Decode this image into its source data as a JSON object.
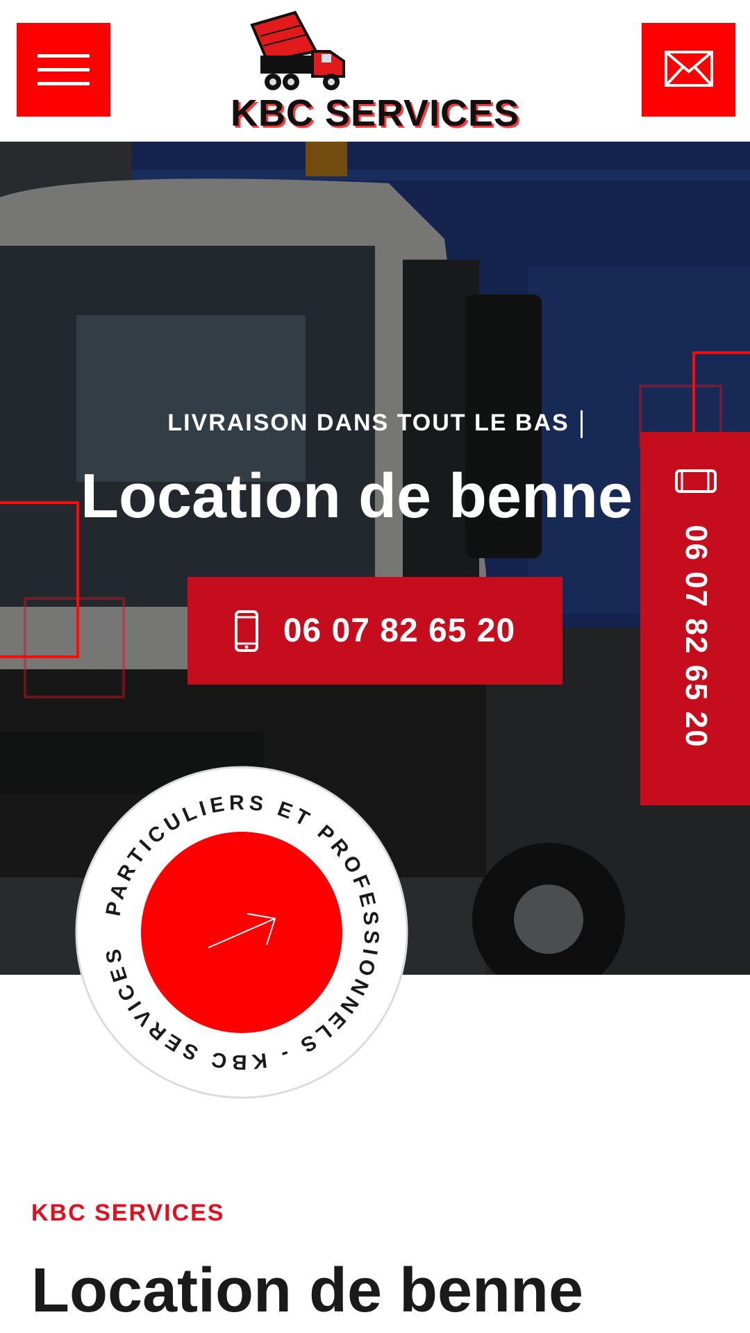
{
  "header": {
    "logo_text": "KBC SERVICES",
    "menu_icon": "hamburger-icon",
    "mail_icon": "envelope-icon",
    "accent": "#ff0000"
  },
  "hero": {
    "subtitle": "LIVRAISON DANS TOUT LE BAS",
    "title": "Location de benne",
    "cta_phone": "06 07 82 65 20",
    "cta_color": "#c50d1d",
    "phone_icon": "mobile-phone-icon"
  },
  "side_tab": {
    "phone": "06 07 82 65 20",
    "icon": "mobile-phone-icon"
  },
  "badge": {
    "ring_text": "PARTICULIERS ET PROFESSIONNELS - KBC SERVICES -",
    "icon": "arrow-up-right-icon"
  },
  "intro": {
    "kicker": "KBC SERVICES",
    "title": "Location de benne"
  }
}
